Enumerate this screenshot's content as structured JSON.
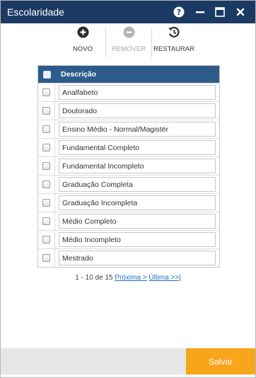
{
  "window": {
    "title": "Escolaridade"
  },
  "titlebar_icons": {
    "help": "help-icon",
    "minimize": "minimize-icon",
    "maximize": "maximize-icon",
    "close": "close-icon"
  },
  "toolbar": {
    "novo_label": "NOVO",
    "remover_label": "REMOVER",
    "restaurar_label": "RESTAURAR",
    "remover_disabled": true
  },
  "grid": {
    "header": "Descrição",
    "rows": [
      "Analfabeto",
      "Doutorado",
      "Ensino Médio - Normal/Magistér",
      "Fundamental Completo",
      "Fundamental Incompleto",
      "Graduação Completa",
      "Graduação Incompleta",
      "Médio Completo",
      "Médio Incompleto",
      "Mestrado"
    ]
  },
  "pager": {
    "range": "1 - 10 de 15",
    "next": "Próxima >",
    "last": "Última >>|"
  },
  "footer": {
    "save_label": "Salvar"
  },
  "colors": {
    "titlebar": "#1b3a63",
    "grid_header": "#2e5c8a",
    "save_button": "#f7a51b",
    "link": "#1c6fc0"
  }
}
